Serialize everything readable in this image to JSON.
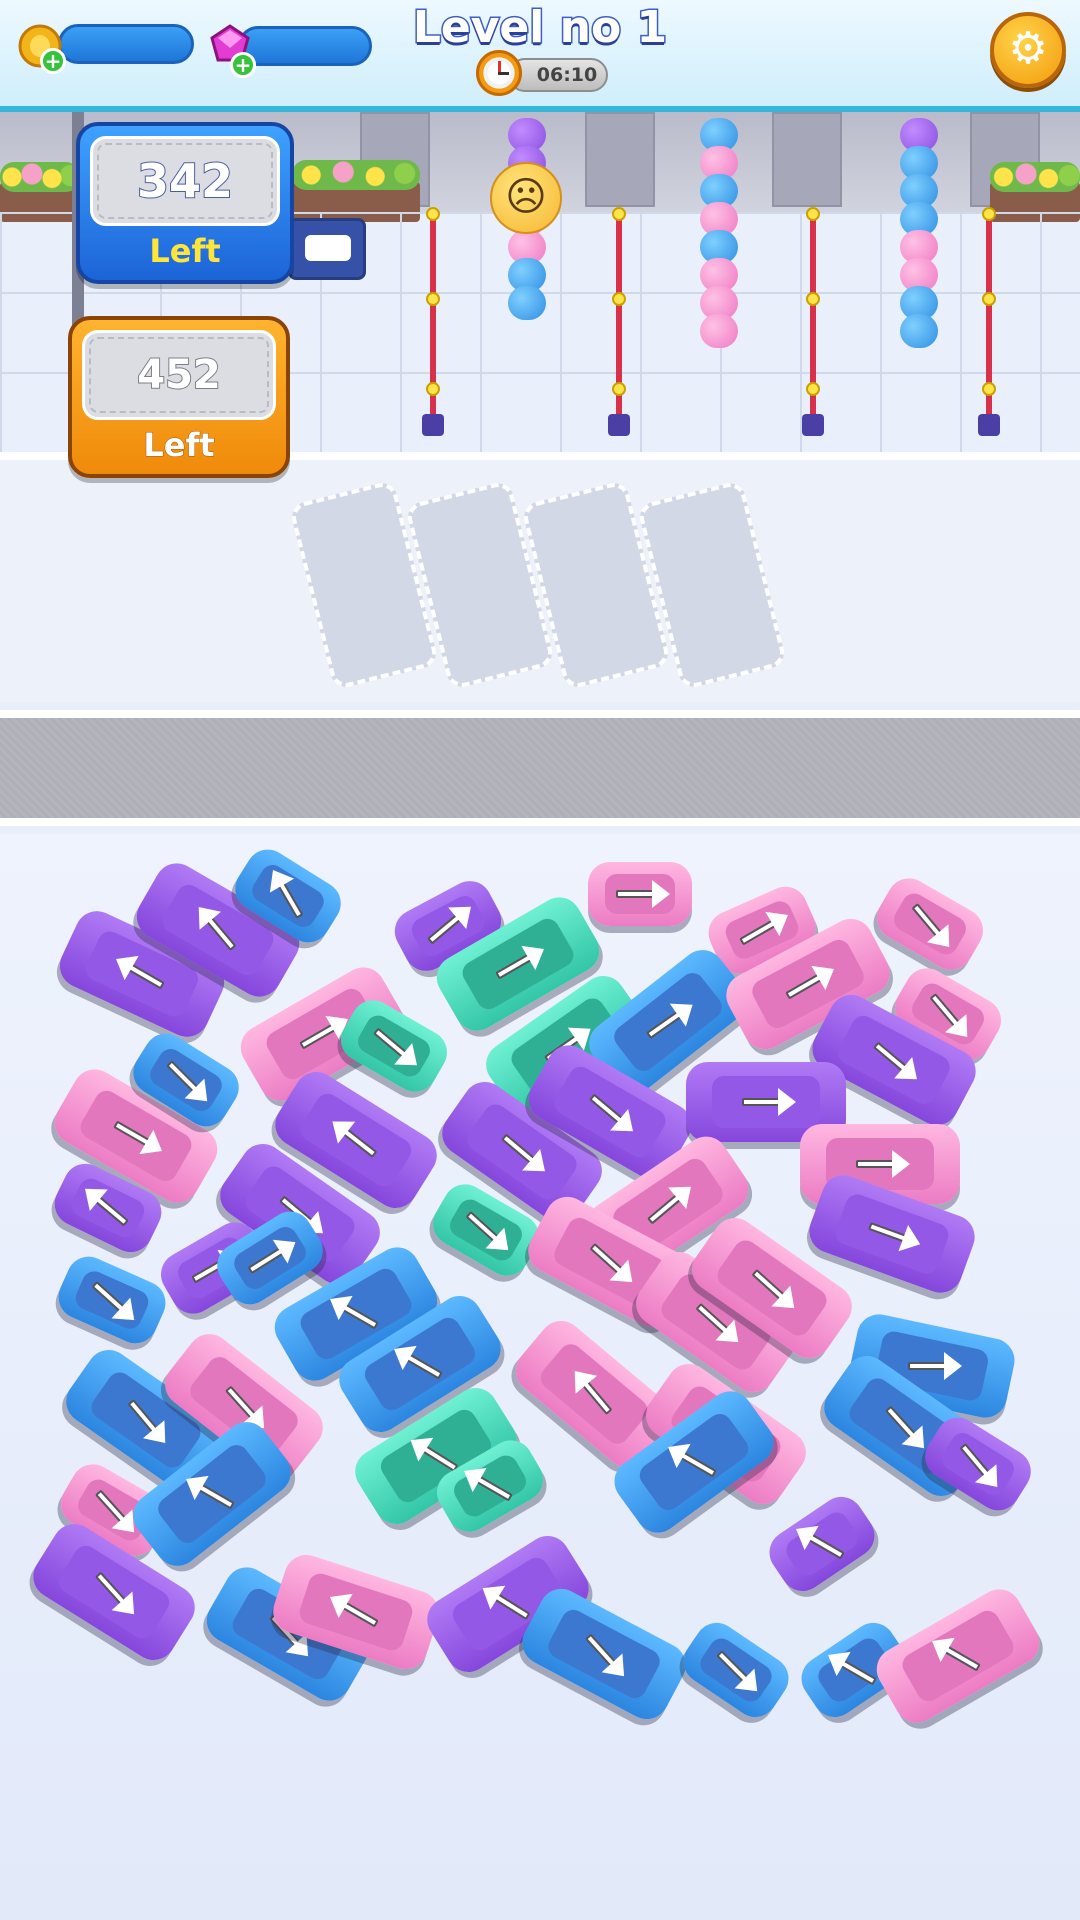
{
  "hud": {
    "title": "Level no 1",
    "timer": "06:10",
    "coin_icon": "coin-icon",
    "gem_icon": "gem-icon",
    "plus_label": "+",
    "settings_icon": "gear-icon",
    "settings_glyph": "⚙"
  },
  "counters": {
    "primary": {
      "value": "342",
      "label": "Left"
    },
    "secondary": {
      "value": "452",
      "label": "Left"
    }
  },
  "station": {
    "face_glyph": "☹",
    "queues": [
      [
        "purple",
        "purple",
        "pink",
        "pink",
        "pink",
        "blue",
        "blue"
      ],
      [
        "blue",
        "pink",
        "blue",
        "pink",
        "blue",
        "pink",
        "pink",
        "pink"
      ],
      [
        "purple",
        "blue",
        "blue",
        "blue",
        "pink",
        "pink",
        "blue",
        "blue"
      ]
    ]
  },
  "parking_slots": {
    "count": 4
  },
  "colors": {
    "purple": "#9458e6",
    "pink": "#ec7cc4",
    "blue": "#2c86e0",
    "teal": "#33c6a7",
    "hud_accent": "#36b6d8",
    "settings": "#f39a0c"
  },
  "vehicles": [
    {
      "color": "purple",
      "kind": "bus"
    },
    {
      "color": "purple",
      "kind": "bus"
    },
    {
      "color": "blue",
      "kind": "car"
    },
    {
      "color": "pink",
      "kind": "bus"
    },
    {
      "color": "purple",
      "kind": "car"
    },
    {
      "color": "teal",
      "kind": "bus"
    },
    {
      "color": "pink",
      "kind": "car"
    },
    {
      "color": "pink",
      "kind": "car"
    },
    {
      "color": "pink",
      "kind": "car"
    },
    {
      "color": "teal",
      "kind": "car"
    },
    {
      "color": "teal",
      "kind": "bus"
    },
    {
      "color": "blue",
      "kind": "bus"
    },
    {
      "color": "pink",
      "kind": "bus"
    },
    {
      "color": "pink",
      "kind": "car"
    },
    {
      "color": "pink",
      "kind": "bus"
    },
    {
      "color": "blue",
      "kind": "car"
    },
    {
      "color": "purple",
      "kind": "bus"
    },
    {
      "color": "purple",
      "kind": "bus"
    },
    {
      "color": "purple",
      "kind": "bus"
    },
    {
      "color": "purple",
      "kind": "bus"
    },
    {
      "color": "purple",
      "kind": "bus"
    },
    {
      "color": "purple",
      "kind": "bus"
    },
    {
      "color": "pink",
      "kind": "bus"
    },
    {
      "color": "purple",
      "kind": "car"
    },
    {
      "color": "purple",
      "kind": "car"
    },
    {
      "color": "blue",
      "kind": "car"
    },
    {
      "color": "teal",
      "kind": "car"
    },
    {
      "color": "pink",
      "kind": "bus"
    },
    {
      "color": "purple",
      "kind": "bus"
    },
    {
      "color": "blue",
      "kind": "car"
    },
    {
      "color": "blue",
      "kind": "bus"
    },
    {
      "color": "blue",
      "kind": "bus"
    },
    {
      "color": "pink",
      "kind": "bus"
    },
    {
      "color": "pink",
      "kind": "bus"
    },
    {
      "color": "pink",
      "kind": "bus"
    },
    {
      "color": "blue",
      "kind": "bus"
    },
    {
      "color": "blue",
      "kind": "bus"
    },
    {
      "color": "pink",
      "kind": "bus"
    },
    {
      "color": "teal",
      "kind": "bus"
    },
    {
      "color": "pink",
      "kind": "bus"
    },
    {
      "color": "pink",
      "kind": "bus"
    },
    {
      "color": "blue",
      "kind": "bus"
    },
    {
      "color": "purple",
      "kind": "car"
    },
    {
      "color": "pink",
      "kind": "car"
    },
    {
      "color": "blue",
      "kind": "bus"
    },
    {
      "color": "teal",
      "kind": "car"
    },
    {
      "color": "blue",
      "kind": "bus"
    },
    {
      "color": "purple",
      "kind": "car"
    },
    {
      "color": "purple",
      "kind": "bus"
    },
    {
      "color": "blue",
      "kind": "bus"
    },
    {
      "color": "pink",
      "kind": "bus"
    },
    {
      "color": "purple",
      "kind": "bus"
    },
    {
      "color": "blue",
      "kind": "bus"
    },
    {
      "color": "blue",
      "kind": "car"
    },
    {
      "color": "blue",
      "kind": "car"
    },
    {
      "color": "pink",
      "kind": "bus"
    }
  ]
}
